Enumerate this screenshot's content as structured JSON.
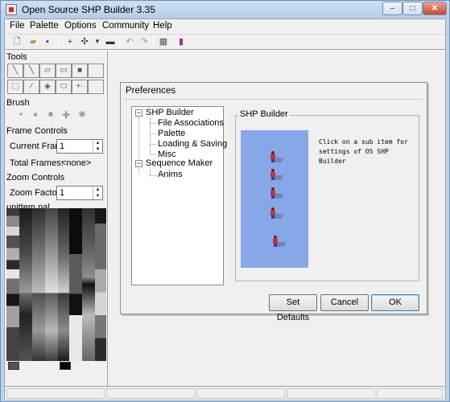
{
  "window": {
    "title": "Open Source SHP Builder 3.35"
  },
  "window_controls": {
    "minimize": "–",
    "maximize": "□",
    "close": "✕"
  },
  "menu": [
    "File",
    "Palette",
    "Options",
    "Community",
    "Help"
  ],
  "toolbar_icons": [
    "new-file-icon",
    "open-folder-icon",
    "save-disk-icon",
    "add-icon",
    "shuffle-icon",
    "dropdown-arrow-icon",
    "separator",
    "undo-icon",
    "redo-icon",
    "separator",
    "properties-icon",
    "book-icon"
  ],
  "left_panel": {
    "tools_label": "Tools",
    "tools": [
      "line-tool-icon",
      "line-diagonal-tool-icon",
      "eraser-tool-icon",
      "rectangle-tool-icon",
      "filled-rectangle-tool-icon",
      "blank-tool",
      "select-tool-icon",
      "dropper-tool-icon",
      "fill-tool-icon",
      "ellipse-tool-icon",
      "move-tool-icon",
      "blank-tool"
    ],
    "brush_label": "Brush",
    "brushes": [
      "brush-1px-icon",
      "brush-2px-icon",
      "brush-3px-icon",
      "brush-4px-icon",
      "brush-spray-icon"
    ],
    "frame_controls_label": "Frame Controls",
    "current_frame_label": "Current Frame",
    "current_frame_value": "1",
    "total_frames_label": "Total Frames:",
    "total_frames_value": "<none>",
    "zoom_controls_label": "Zoom Controls",
    "zoom_factor_label": "Zoom Factor",
    "zoom_factor_value": "1",
    "palette_label": "unittem.pal"
  },
  "preferences": {
    "title": "Preferences",
    "tree": [
      {
        "label": "SHP Builder",
        "expanded": "−"
      },
      {
        "label": "File Associations"
      },
      {
        "label": "Palette"
      },
      {
        "label": "Loading & Saving"
      },
      {
        "label": "Misc"
      },
      {
        "label": "Sequence Maker",
        "expanded": "−"
      },
      {
        "label": "Anims"
      }
    ],
    "group_label": "SHP Builder",
    "hint_lines": [
      "Click on a sub item for",
      "settings of OS SHP",
      "Builder"
    ],
    "buttons": {
      "set_defaults": "Set Defaults",
      "cancel": "Cancel",
      "ok": "OK"
    },
    "preview_color": "#86a8e8"
  },
  "colors": {
    "accent": "#3c7fb1",
    "title_bg": "#bcd3ee",
    "close_btn": "#c9482e"
  }
}
